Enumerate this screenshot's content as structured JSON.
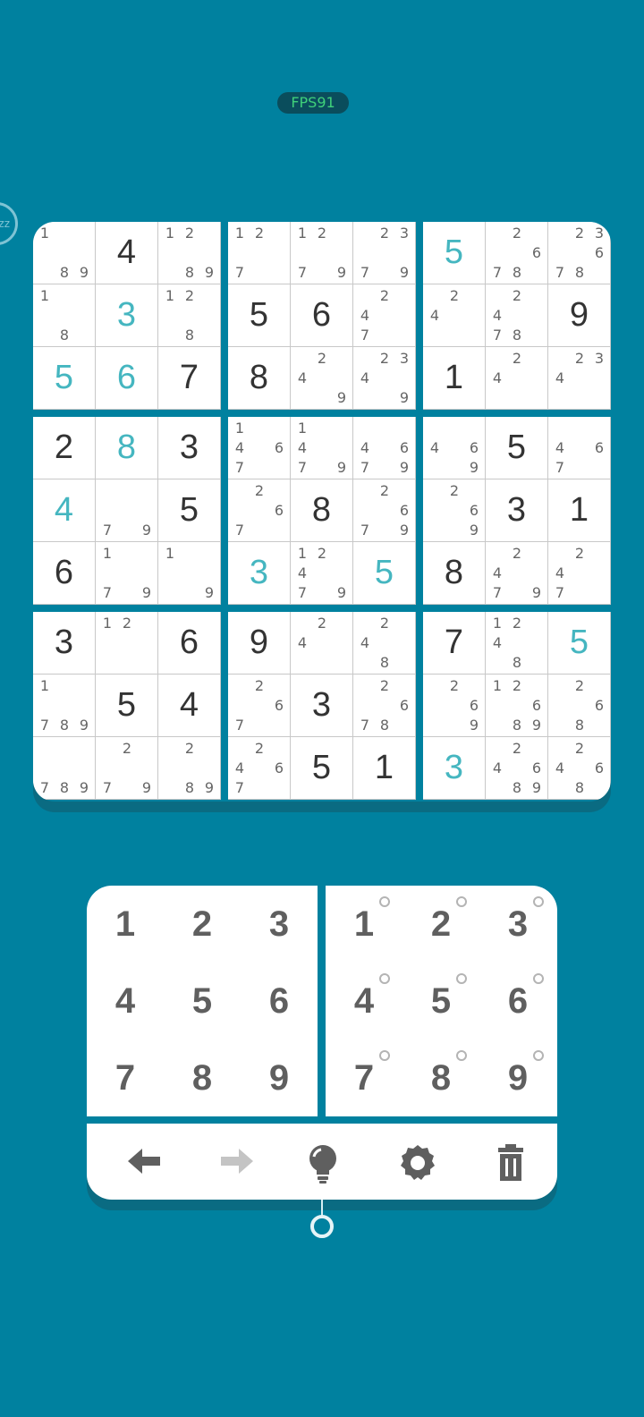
{
  "fps": "FPS91",
  "timer_text": "zz",
  "board": [
    [
      {
        "v": "",
        "n": [
          1,
          8,
          9
        ]
      },
      {
        "v": "4",
        "t": "given"
      },
      {
        "v": "",
        "n": [
          1,
          2,
          8,
          9
        ]
      },
      {
        "v": "",
        "n": [
          1,
          2,
          7
        ]
      },
      {
        "v": "",
        "n": [
          1,
          2,
          7,
          9
        ]
      },
      {
        "v": "",
        "n": [
          2,
          3,
          7,
          9
        ]
      },
      {
        "v": "5",
        "t": "user"
      },
      {
        "v": "",
        "n": [
          2,
          6,
          7,
          8
        ]
      },
      {
        "v": "",
        "n": [
          2,
          3,
          6,
          7,
          8
        ]
      }
    ],
    [
      {
        "v": "",
        "n": [
          1,
          8
        ]
      },
      {
        "v": "3",
        "t": "user"
      },
      {
        "v": "",
        "n": [
          1,
          2,
          8
        ]
      },
      {
        "v": "5",
        "t": "given"
      },
      {
        "v": "6",
        "t": "given"
      },
      {
        "v": "",
        "n": [
          2,
          4,
          7
        ]
      },
      {
        "v": "",
        "n": [
          2,
          4
        ]
      },
      {
        "v": "",
        "n": [
          2,
          4,
          7,
          8
        ]
      },
      {
        "v": "9",
        "t": "given"
      }
    ],
    [
      {
        "v": "5",
        "t": "user"
      },
      {
        "v": "6",
        "t": "user"
      },
      {
        "v": "7",
        "t": "given"
      },
      {
        "v": "8",
        "t": "given"
      },
      {
        "v": "",
        "n": [
          2,
          4,
          9
        ]
      },
      {
        "v": "",
        "n": [
          2,
          3,
          4,
          9
        ]
      },
      {
        "v": "1",
        "t": "given"
      },
      {
        "v": "",
        "n": [
          2,
          4
        ]
      },
      {
        "v": "",
        "n": [
          2,
          3,
          4
        ]
      }
    ],
    [
      {
        "v": "2",
        "t": "given"
      },
      {
        "v": "8",
        "t": "user"
      },
      {
        "v": "3",
        "t": "given"
      },
      {
        "v": "",
        "n": [
          1,
          4,
          6,
          7
        ]
      },
      {
        "v": "",
        "n": [
          1,
          4,
          7,
          9
        ]
      },
      {
        "v": "",
        "n": [
          4,
          6,
          7,
          9
        ]
      },
      {
        "v": "",
        "n": [
          4,
          6,
          9
        ]
      },
      {
        "v": "5",
        "t": "given"
      },
      {
        "v": "",
        "n": [
          4,
          6,
          7
        ]
      }
    ],
    [
      {
        "v": "4",
        "t": "user"
      },
      {
        "v": "",
        "n": [
          7,
          9
        ]
      },
      {
        "v": "5",
        "t": "given"
      },
      {
        "v": "",
        "n": [
          2,
          6,
          7
        ]
      },
      {
        "v": "8",
        "t": "given"
      },
      {
        "v": "",
        "n": [
          2,
          6,
          7,
          9
        ]
      },
      {
        "v": "",
        "n": [
          2,
          6,
          9
        ]
      },
      {
        "v": "3",
        "t": "given"
      },
      {
        "v": "1",
        "t": "given"
      }
    ],
    [
      {
        "v": "6",
        "t": "given"
      },
      {
        "v": "",
        "n": [
          1,
          7,
          9
        ]
      },
      {
        "v": "",
        "n": [
          1,
          9
        ]
      },
      {
        "v": "3",
        "t": "user"
      },
      {
        "v": "",
        "n": [
          1,
          2,
          4,
          7,
          9
        ]
      },
      {
        "v": "5",
        "t": "user"
      },
      {
        "v": "8",
        "t": "given"
      },
      {
        "v": "",
        "n": [
          2,
          4,
          7,
          9
        ]
      },
      {
        "v": "",
        "n": [
          2,
          4,
          7
        ]
      }
    ],
    [
      {
        "v": "3",
        "t": "given"
      },
      {
        "v": "",
        "n": [
          1,
          2
        ]
      },
      {
        "v": "6",
        "t": "given"
      },
      {
        "v": "9",
        "t": "given"
      },
      {
        "v": "",
        "n": [
          2,
          4
        ]
      },
      {
        "v": "",
        "n": [
          2,
          4,
          8
        ]
      },
      {
        "v": "7",
        "t": "given"
      },
      {
        "v": "",
        "n": [
          1,
          2,
          4,
          8
        ]
      },
      {
        "v": "5",
        "t": "user"
      }
    ],
    [
      {
        "v": "",
        "n": [
          1,
          7,
          8,
          9
        ]
      },
      {
        "v": "5",
        "t": "given"
      },
      {
        "v": "4",
        "t": "given"
      },
      {
        "v": "",
        "n": [
          2,
          6,
          7
        ]
      },
      {
        "v": "3",
        "t": "given"
      },
      {
        "v": "",
        "n": [
          2,
          6,
          7,
          8
        ]
      },
      {
        "v": "",
        "n": [
          2,
          6,
          9
        ]
      },
      {
        "v": "",
        "n": [
          1,
          2,
          6,
          8,
          9
        ]
      },
      {
        "v": "",
        "n": [
          2,
          6,
          8
        ]
      }
    ],
    [
      {
        "v": "",
        "n": [
          7,
          8,
          9
        ]
      },
      {
        "v": "",
        "n": [
          2,
          7,
          9
        ]
      },
      {
        "v": "",
        "n": [
          2,
          8,
          9
        ]
      },
      {
        "v": "",
        "n": [
          2,
          4,
          6,
          7
        ]
      },
      {
        "v": "5",
        "t": "given"
      },
      {
        "v": "1",
        "t": "given"
      },
      {
        "v": "3",
        "t": "user"
      },
      {
        "v": "",
        "n": [
          2,
          4,
          6,
          8,
          9
        ]
      },
      {
        "v": "",
        "n": [
          2,
          4,
          6,
          8
        ]
      }
    ]
  ],
  "keypad": {
    "digits": [
      "1",
      "2",
      "3",
      "4",
      "5",
      "6",
      "7",
      "8",
      "9"
    ],
    "pencil_digits": [
      "1",
      "2",
      "3",
      "4",
      "5",
      "6",
      "7",
      "8",
      "9"
    ]
  },
  "toolbar": {
    "items": [
      {
        "name": "undo-button",
        "icon": "arrow-left-icon",
        "enabled": true
      },
      {
        "name": "redo-button",
        "icon": "arrow-right-icon",
        "enabled": false
      },
      {
        "name": "hint-button",
        "icon": "lightbulb-icon",
        "enabled": true
      },
      {
        "name": "settings-button",
        "icon": "gear-icon",
        "enabled": true
      },
      {
        "name": "delete-button",
        "icon": "trash-icon",
        "enabled": true
      }
    ]
  },
  "colors": {
    "background": "#00819f",
    "given_digit": "#333333",
    "user_digit": "#45b6c0",
    "note_digit": "#666666",
    "icon": "#5f5f5f",
    "icon_disabled": "#c4c4c4"
  }
}
